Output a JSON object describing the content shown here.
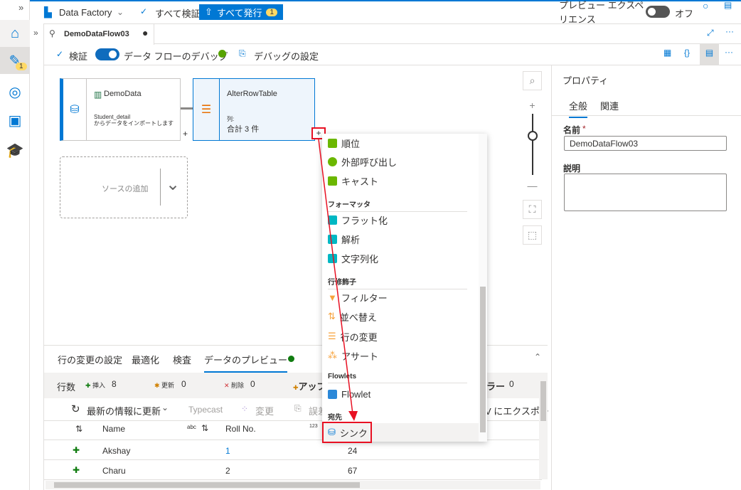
{
  "top": {
    "expand": "»",
    "factory": "Data Factory",
    "validate_all": "すべて検証",
    "publish_all": "すべて発行",
    "publish_count": "1",
    "preview_label": "プレビュー エクスペリエンス",
    "preview_state": "オフ"
  },
  "sidebar": {
    "author_badge": "1"
  },
  "tab": {
    "title": "DemoDataFlow03",
    "expand": "»"
  },
  "toolbar": {
    "validate": "検証",
    "debug": "データ フローのデバッグ",
    "debug_settings": "デバッグの設定"
  },
  "nodes": {
    "source_title": "DemoData",
    "source_desc1": "Student_detail",
    "source_desc2": "からデータをインポートします",
    "alter_title": "AlterRowTable",
    "alter_cols_label": "列:",
    "alter_cols": "合計 3 件",
    "add_source": "ソースの追加",
    "plus": "+"
  },
  "menu": {
    "items": [
      {
        "label": "順位",
        "color": "#6bb700"
      },
      {
        "label": "外部呼び出し",
        "color": "#6bb700"
      },
      {
        "label": "キャスト",
        "color": "#6bb700"
      }
    ],
    "h_formatter": "フォーマッタ",
    "formatters": [
      {
        "label": "フラット化",
        "color": "#00b7c3"
      },
      {
        "label": "解析",
        "color": "#00b7c3"
      },
      {
        "label": "文字列化",
        "color": "#00b7c3"
      }
    ],
    "h_row": "行修飾子",
    "row_mods": [
      {
        "label": "フィルター",
        "color": "#f7a23b"
      },
      {
        "label": "並べ替え",
        "color": "#f7a23b"
      },
      {
        "label": "行の変更",
        "color": "#f7a23b"
      },
      {
        "label": "アサート",
        "color": "#f7a23b"
      }
    ],
    "h_flowlets": "Flowlets",
    "flowlet": "Flowlet",
    "h_dest": "宛先",
    "sink": "シンク"
  },
  "props": {
    "title": "プロパティ",
    "tab_general": "全般",
    "tab_related": "関連",
    "name_label": "名前",
    "required": "*",
    "name_value": "DemoDataFlow03",
    "desc_label": "説明"
  },
  "bottom": {
    "tabs": [
      "行の変更の設定",
      "最適化",
      "検査",
      "データのプレビュー"
    ],
    "rows_label": "行数",
    "insert_label": "挿入",
    "insert": "8",
    "update_label": "更新",
    "update": "0",
    "delete_label": "削除",
    "delete": "0",
    "upsert_label": "アップ",
    "error_label": "ラー",
    "error": "0",
    "refresh": "最新の情報に更新",
    "typecast": "Typecast",
    "modify": "変更",
    "error_btn": "誤差",
    "export": "V にエクスポー",
    "cols": [
      "Name",
      "Roll No."
    ],
    "type_abc": "abc",
    "type_123": "123",
    "data": [
      {
        "name": "Akshay",
        "roll": "1",
        "val": "24"
      },
      {
        "name": "Charu",
        "roll": "2",
        "val": "67"
      }
    ]
  }
}
